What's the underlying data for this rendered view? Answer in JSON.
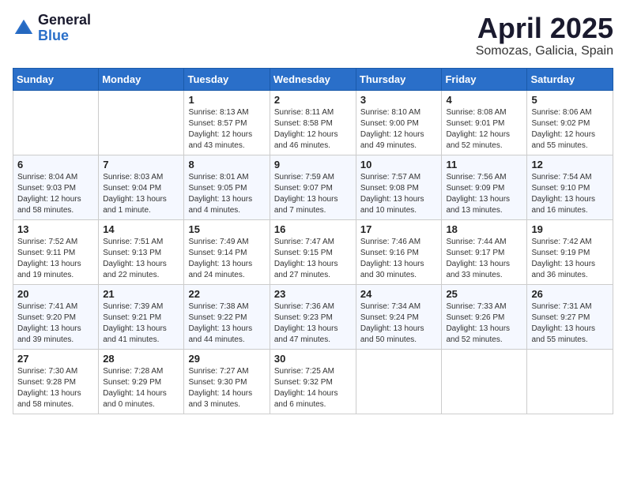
{
  "header": {
    "logo_general": "General",
    "logo_blue": "Blue",
    "month_title": "April 2025",
    "location": "Somozas, Galicia, Spain"
  },
  "weekdays": [
    "Sunday",
    "Monday",
    "Tuesday",
    "Wednesday",
    "Thursday",
    "Friday",
    "Saturday"
  ],
  "weeks": [
    [
      {
        "day": "",
        "info": ""
      },
      {
        "day": "",
        "info": ""
      },
      {
        "day": "1",
        "info": "Sunrise: 8:13 AM\nSunset: 8:57 PM\nDaylight: 12 hours and 43 minutes."
      },
      {
        "day": "2",
        "info": "Sunrise: 8:11 AM\nSunset: 8:58 PM\nDaylight: 12 hours and 46 minutes."
      },
      {
        "day": "3",
        "info": "Sunrise: 8:10 AM\nSunset: 9:00 PM\nDaylight: 12 hours and 49 minutes."
      },
      {
        "day": "4",
        "info": "Sunrise: 8:08 AM\nSunset: 9:01 PM\nDaylight: 12 hours and 52 minutes."
      },
      {
        "day": "5",
        "info": "Sunrise: 8:06 AM\nSunset: 9:02 PM\nDaylight: 12 hours and 55 minutes."
      }
    ],
    [
      {
        "day": "6",
        "info": "Sunrise: 8:04 AM\nSunset: 9:03 PM\nDaylight: 12 hours and 58 minutes."
      },
      {
        "day": "7",
        "info": "Sunrise: 8:03 AM\nSunset: 9:04 PM\nDaylight: 13 hours and 1 minute."
      },
      {
        "day": "8",
        "info": "Sunrise: 8:01 AM\nSunset: 9:05 PM\nDaylight: 13 hours and 4 minutes."
      },
      {
        "day": "9",
        "info": "Sunrise: 7:59 AM\nSunset: 9:07 PM\nDaylight: 13 hours and 7 minutes."
      },
      {
        "day": "10",
        "info": "Sunrise: 7:57 AM\nSunset: 9:08 PM\nDaylight: 13 hours and 10 minutes."
      },
      {
        "day": "11",
        "info": "Sunrise: 7:56 AM\nSunset: 9:09 PM\nDaylight: 13 hours and 13 minutes."
      },
      {
        "day": "12",
        "info": "Sunrise: 7:54 AM\nSunset: 9:10 PM\nDaylight: 13 hours and 16 minutes."
      }
    ],
    [
      {
        "day": "13",
        "info": "Sunrise: 7:52 AM\nSunset: 9:11 PM\nDaylight: 13 hours and 19 minutes."
      },
      {
        "day": "14",
        "info": "Sunrise: 7:51 AM\nSunset: 9:13 PM\nDaylight: 13 hours and 22 minutes."
      },
      {
        "day": "15",
        "info": "Sunrise: 7:49 AM\nSunset: 9:14 PM\nDaylight: 13 hours and 24 minutes."
      },
      {
        "day": "16",
        "info": "Sunrise: 7:47 AM\nSunset: 9:15 PM\nDaylight: 13 hours and 27 minutes."
      },
      {
        "day": "17",
        "info": "Sunrise: 7:46 AM\nSunset: 9:16 PM\nDaylight: 13 hours and 30 minutes."
      },
      {
        "day": "18",
        "info": "Sunrise: 7:44 AM\nSunset: 9:17 PM\nDaylight: 13 hours and 33 minutes."
      },
      {
        "day": "19",
        "info": "Sunrise: 7:42 AM\nSunset: 9:19 PM\nDaylight: 13 hours and 36 minutes."
      }
    ],
    [
      {
        "day": "20",
        "info": "Sunrise: 7:41 AM\nSunset: 9:20 PM\nDaylight: 13 hours and 39 minutes."
      },
      {
        "day": "21",
        "info": "Sunrise: 7:39 AM\nSunset: 9:21 PM\nDaylight: 13 hours and 41 minutes."
      },
      {
        "day": "22",
        "info": "Sunrise: 7:38 AM\nSunset: 9:22 PM\nDaylight: 13 hours and 44 minutes."
      },
      {
        "day": "23",
        "info": "Sunrise: 7:36 AM\nSunset: 9:23 PM\nDaylight: 13 hours and 47 minutes."
      },
      {
        "day": "24",
        "info": "Sunrise: 7:34 AM\nSunset: 9:24 PM\nDaylight: 13 hours and 50 minutes."
      },
      {
        "day": "25",
        "info": "Sunrise: 7:33 AM\nSunset: 9:26 PM\nDaylight: 13 hours and 52 minutes."
      },
      {
        "day": "26",
        "info": "Sunrise: 7:31 AM\nSunset: 9:27 PM\nDaylight: 13 hours and 55 minutes."
      }
    ],
    [
      {
        "day": "27",
        "info": "Sunrise: 7:30 AM\nSunset: 9:28 PM\nDaylight: 13 hours and 58 minutes."
      },
      {
        "day": "28",
        "info": "Sunrise: 7:28 AM\nSunset: 9:29 PM\nDaylight: 14 hours and 0 minutes."
      },
      {
        "day": "29",
        "info": "Sunrise: 7:27 AM\nSunset: 9:30 PM\nDaylight: 14 hours and 3 minutes."
      },
      {
        "day": "30",
        "info": "Sunrise: 7:25 AM\nSunset: 9:32 PM\nDaylight: 14 hours and 6 minutes."
      },
      {
        "day": "",
        "info": ""
      },
      {
        "day": "",
        "info": ""
      },
      {
        "day": "",
        "info": ""
      }
    ]
  ]
}
